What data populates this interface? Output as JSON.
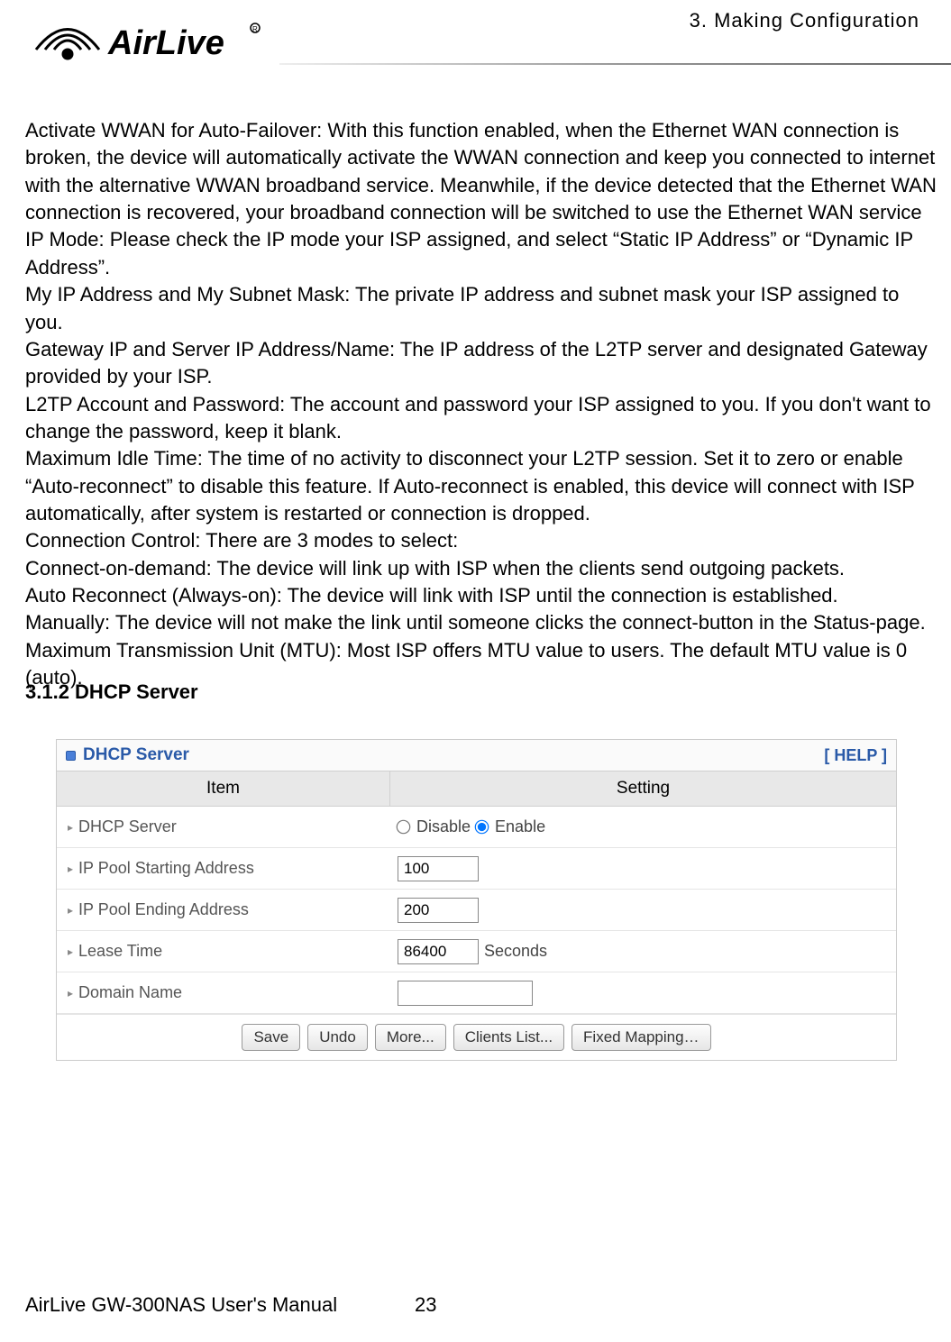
{
  "header": {
    "chapter_label": "3.  Making  Configuration",
    "logo_text": "AirLive"
  },
  "body": {
    "paragraphs": [
      "Activate WWAN for Auto-Failover: With this function enabled, when the Ethernet WAN connection is broken, the device will automatically activate the WWAN connection and keep you connected to internet with the alternative WWAN broadband service. Meanwhile, if the device detected that the Ethernet WAN connection is recovered, your broadband connection will be switched to use the Ethernet WAN service",
      "IP Mode: Please check the IP mode your ISP assigned, and select “Static IP Address” or “Dynamic IP Address”.",
      "My IP Address and My Subnet Mask: The private IP address and subnet mask your ISP assigned to you.",
      "Gateway IP and Server IP Address/Name: The IP address of the L2TP server and designated Gateway provided by your ISP.",
      "L2TP Account and Password: The account and password your ISP assigned to you. If you don't want to change the password, keep it blank.",
      "Maximum Idle Time: The time of no activity to disconnect your L2TP session. Set it to zero or enable “Auto-reconnect” to disable this feature. If Auto-reconnect is enabled, this device will connect with ISP automatically, after system is restarted or connection is dropped.",
      "Connection Control: There are 3 modes to select:",
      "Connect-on-demand: The device will link up with ISP when the clients send outgoing packets.",
      "Auto Reconnect (Always-on): The device will link with ISP until the connection is established.",
      "Manually: The device will not make the link until someone clicks the connect-button in the Status-page.",
      "Maximum Transmission Unit (MTU): Most ISP offers MTU value to users. The default MTU value is 0 (auto)."
    ]
  },
  "section_heading": "3.1.2 DHCP Server",
  "panel": {
    "title": "DHCP Server",
    "help": "[ HELP ]",
    "columns": {
      "item": "Item",
      "setting": "Setting"
    },
    "rows": {
      "dhcp_server": {
        "label": "DHCP Server",
        "disable": "Disable",
        "enable": "Enable",
        "selected": "enable"
      },
      "ip_start": {
        "label": "IP Pool Starting Address",
        "value": "100"
      },
      "ip_end": {
        "label": "IP Pool Ending Address",
        "value": "200"
      },
      "lease": {
        "label": "Lease Time",
        "value": "86400",
        "unit": "Seconds"
      },
      "domain": {
        "label": "Domain Name",
        "value": ""
      }
    },
    "buttons": {
      "save": "Save",
      "undo": "Undo",
      "more": "More...",
      "clients": "Clients List...",
      "fixed": "Fixed Mapping…"
    }
  },
  "footer": {
    "manual": "AirLive GW-300NAS User's Manual",
    "page": "23"
  }
}
